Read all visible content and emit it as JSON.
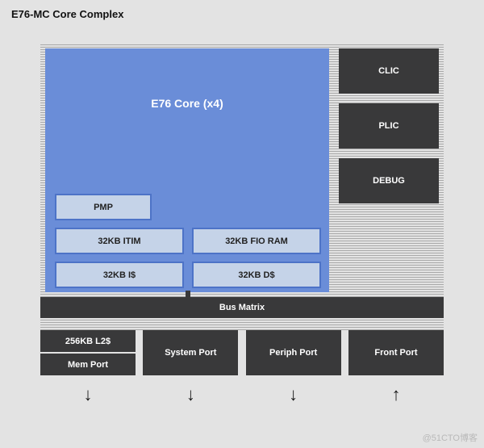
{
  "title": "E76-MC Core Complex",
  "watermark": "@51CTO博客",
  "core": {
    "label": "E76 Core (x4)",
    "blocks": {
      "pmp": "PMP",
      "itim": "32KB ITIM",
      "fioram": "32KB FIO RAM",
      "icache": "32KB I$",
      "dcache": "32KB D$"
    }
  },
  "side": {
    "clic": "CLIC",
    "plic": "PLIC",
    "debug": "DEBUG"
  },
  "bus": "Bus Matrix",
  "ports": {
    "l2": "256KB L2$",
    "mem": "Mem Port",
    "system": "System Port",
    "periph": "Periph Port",
    "front": "Front Port"
  },
  "arrows": {
    "down": "↓",
    "up": "↑"
  }
}
